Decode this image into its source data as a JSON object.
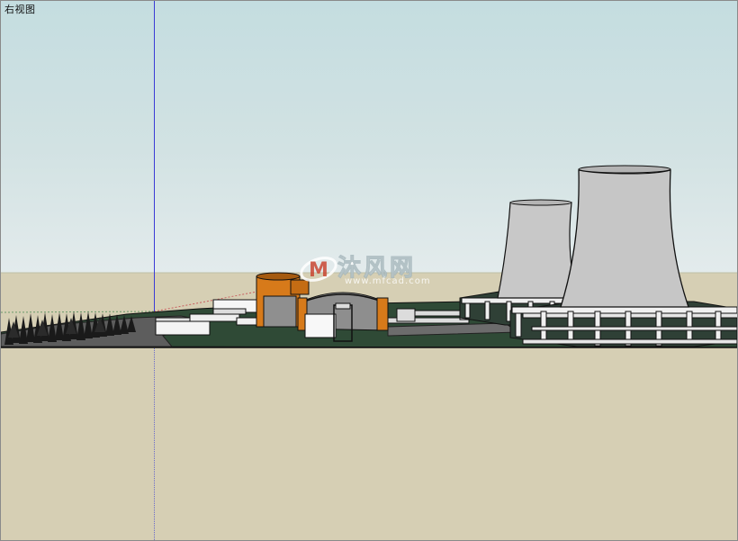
{
  "view": {
    "label": "右视图"
  },
  "watermark": {
    "title": "沐风网",
    "subtitle": "www.mfcad.com"
  },
  "colors": {
    "sky_top": "#c4dde0",
    "ground": "#d6cfb4",
    "site_base": "#2f4a36",
    "cooling_tower": "#c8c8c8",
    "reactor_orange": "#d77a1a",
    "axis_blue": "#3a3ad6"
  },
  "scene": {
    "objects": [
      "tree-row",
      "site-platform",
      "road",
      "reactor-building",
      "turbine-hall",
      "cooling-tower-left",
      "cooling-tower-right",
      "tower-base-ring",
      "pipeline"
    ]
  }
}
